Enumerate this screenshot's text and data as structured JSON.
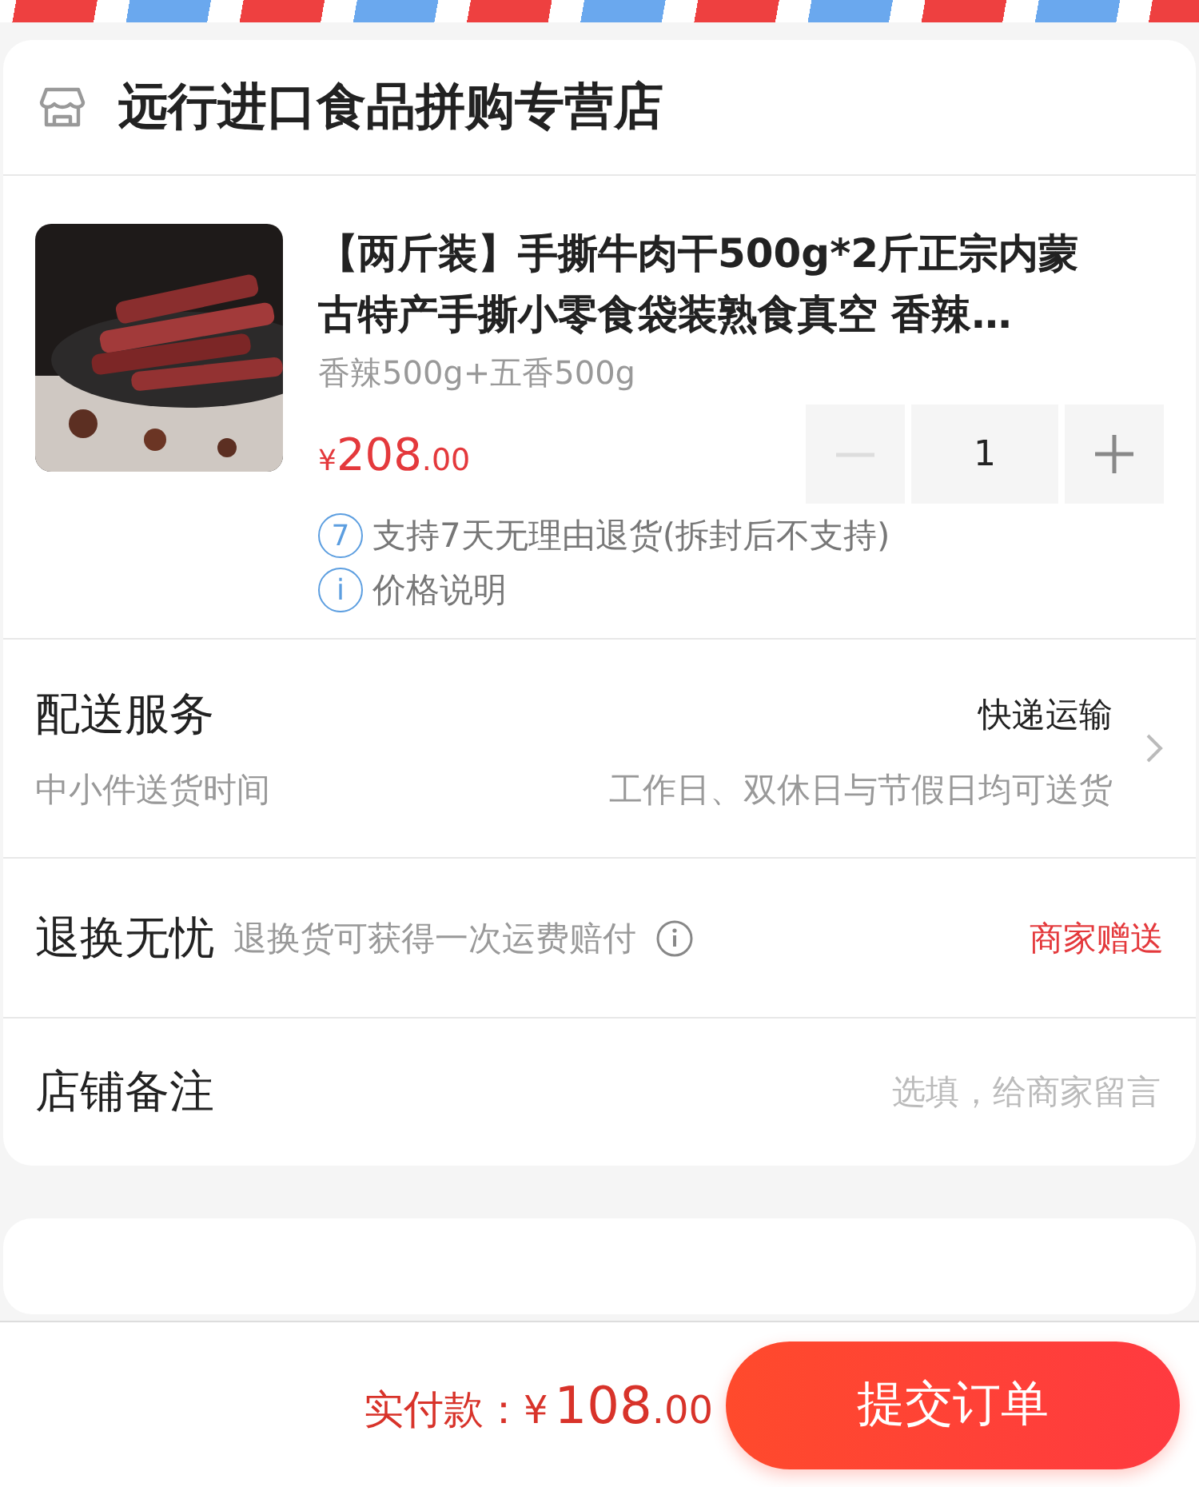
{
  "shop": {
    "name": "远行进口食品拼购专营店"
  },
  "product": {
    "title": "【两斤装】手撕牛肉干500g*2斤正宗内蒙古特产手撕小零食袋装熟食真空 香辣…",
    "spec": "香辣500g+五香500g",
    "price": {
      "currency": "¥",
      "integer": "208",
      "decimal": ".00"
    },
    "quantity": "1",
    "minus_disabled": true,
    "notes": [
      {
        "icon": "7",
        "text": "支持7天无理由退货(拆封后不支持)"
      },
      {
        "icon": "i",
        "text": "价格说明"
      }
    ]
  },
  "rows": [
    {
      "kind": "delivery",
      "label": "配送服务",
      "value": "快递运输",
      "sub_label": "中小件送货时间",
      "sub_value": "工作日、双休日与节假日均可送货"
    },
    {
      "kind": "return",
      "label": "退换无忧",
      "hint": "退换货可获得一次运费赔付",
      "value": "商家赠送"
    },
    {
      "kind": "note",
      "label": "店铺备注",
      "placeholder": "选填，给商家留言"
    }
  ],
  "footer": {
    "label": "实付款：",
    "currency": "¥",
    "integer": "108",
    "decimal": ".00",
    "submit": "提交订单"
  }
}
